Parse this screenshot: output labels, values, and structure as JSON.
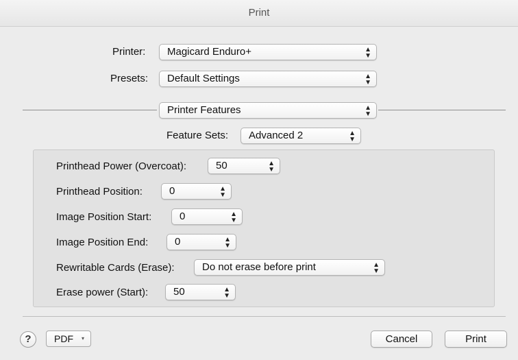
{
  "window": {
    "title": "Print"
  },
  "printer": {
    "label": "Printer:",
    "value": "Magicard Enduro+"
  },
  "presets": {
    "label": "Presets:",
    "value": "Default Settings"
  },
  "section_popup": {
    "value": "Printer Features"
  },
  "feature_sets": {
    "label": "Feature Sets:",
    "value": "Advanced 2"
  },
  "features": [
    {
      "label": "Printhead Power (Overcoat):",
      "value": "50"
    },
    {
      "label": "Printhead Position:",
      "value": "0"
    },
    {
      "label": "Image Position Start:",
      "value": "0"
    },
    {
      "label": "Image Position End:",
      "value": "0"
    },
    {
      "label": "Rewritable Cards (Erase):",
      "value": "Do not erase before print"
    },
    {
      "label": "Erase power (Start):",
      "value": "50"
    }
  ],
  "footer": {
    "help_label": "?",
    "pdf_label": "PDF",
    "pdf_arrow": "▾",
    "cancel_label": "Cancel",
    "print_label": "Print"
  },
  "icons": {
    "popup_arrows": "updown-chevron-icon",
    "pdf_menu": "triangle-down-icon",
    "help": "question-mark-icon"
  }
}
